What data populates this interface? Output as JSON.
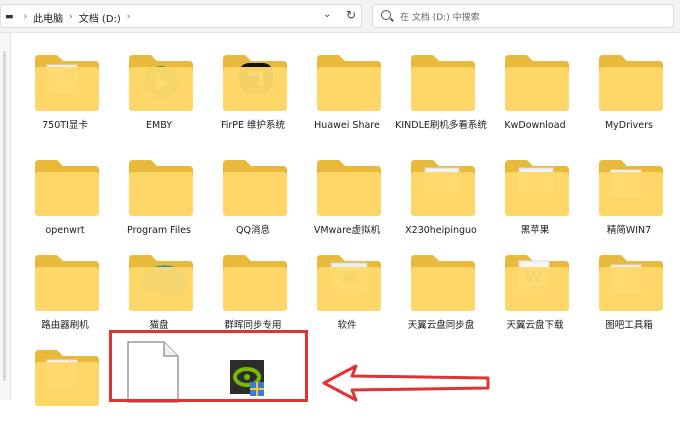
{
  "address": {
    "crumbs": [
      "此电脑",
      "文档 (D:)"
    ],
    "chevron": "⌄",
    "refresh": "↻"
  },
  "search": {
    "placeholder": "在 文档 (D:) 中搜索"
  },
  "folders": [
    {
      "label": "750TI显卡",
      "overlay": "doc"
    },
    {
      "label": "EMBY",
      "overlay": "emby"
    },
    {
      "label": "FirPE 维护系统",
      "overlay": "black"
    },
    {
      "label": "Huawei Share",
      "overlay": ""
    },
    {
      "label": "KINDLE刷机多看系统",
      "overlay": ""
    },
    {
      "label": "KwDownload",
      "overlay": ""
    },
    {
      "label": "MyDrivers",
      "overlay": ""
    },
    {
      "label": "openwrt",
      "overlay": ""
    },
    {
      "label": "Program Files",
      "overlay": ""
    },
    {
      "label": "QQ消息",
      "overlay": ""
    },
    {
      "label": "VMware虚拟机",
      "overlay": ""
    },
    {
      "label": "X230heipinguo",
      "overlay": "photo"
    },
    {
      "label": "黑苹果",
      "overlay": "photo"
    },
    {
      "label": "精简WIN7",
      "overlay": "doc"
    },
    {
      "label": "路由器刷机",
      "overlay": ""
    },
    {
      "label": "猫盘",
      "overlay": "edge"
    },
    {
      "label": "群晖同步专用",
      "overlay": ""
    },
    {
      "label": "软件",
      "overlay": "window"
    },
    {
      "label": "天翼云盘同步盘",
      "overlay": ""
    },
    {
      "label": "天翼云盘下载",
      "overlay": "word"
    },
    {
      "label": "图吧工具箱",
      "overlay": "doc"
    },
    {
      "label": "",
      "overlay": "doc"
    }
  ],
  "files": [
    {
      "kind": "blank"
    },
    {
      "kind": "nvidia"
    }
  ],
  "colors": {
    "folder_back": "#e8b93a",
    "folder_front": "#ffd86a",
    "highlight": "#e03434"
  }
}
